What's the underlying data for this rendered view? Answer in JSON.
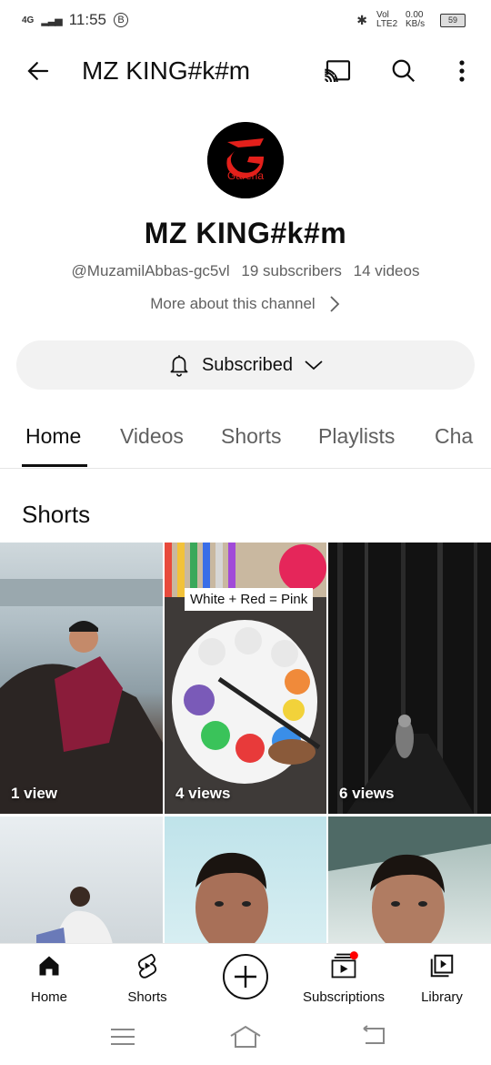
{
  "status_bar": {
    "network": "4G",
    "time": "11:55",
    "b_badge": "B",
    "volte": "Vol LTE2",
    "speed": "0.00 KB/s",
    "battery": "59"
  },
  "top_bar": {
    "title": "MZ KING#k#m",
    "back_icon": "arrow-left-icon",
    "cast_icon": "cast-icon",
    "search_icon": "search-icon",
    "more_icon": "more-vert-icon"
  },
  "channel": {
    "avatar_text": "Garena",
    "name": "MZ KING#k#m",
    "handle": "@MuzamilAbbas-gc5vl",
    "subscribers": "19 subscribers",
    "videos": "14 videos",
    "more_about": "More about this channel",
    "subscribe_label": "Subscribed"
  },
  "tabs": [
    "Home",
    "Videos",
    "Shorts",
    "Playlists",
    "Cha"
  ],
  "active_tab": "Home",
  "section_title": "Shorts",
  "shorts": [
    {
      "views": "1 view"
    },
    {
      "views": "4 views",
      "overlay_text": "White + Red = Pink"
    },
    {
      "views": "6 views"
    },
    {
      "views": ""
    },
    {
      "views": ""
    },
    {
      "views": ""
    }
  ],
  "bottom_nav": {
    "home": "Home",
    "shorts": "Shorts",
    "create_icon": "plus-circle-icon",
    "subscriptions": "Subscriptions",
    "library": "Library"
  },
  "colors": {
    "accent_red": "#ff0000",
    "text_primary": "#0f0f0f",
    "text_secondary": "#606060",
    "chip_bg": "#f2f2f2"
  }
}
